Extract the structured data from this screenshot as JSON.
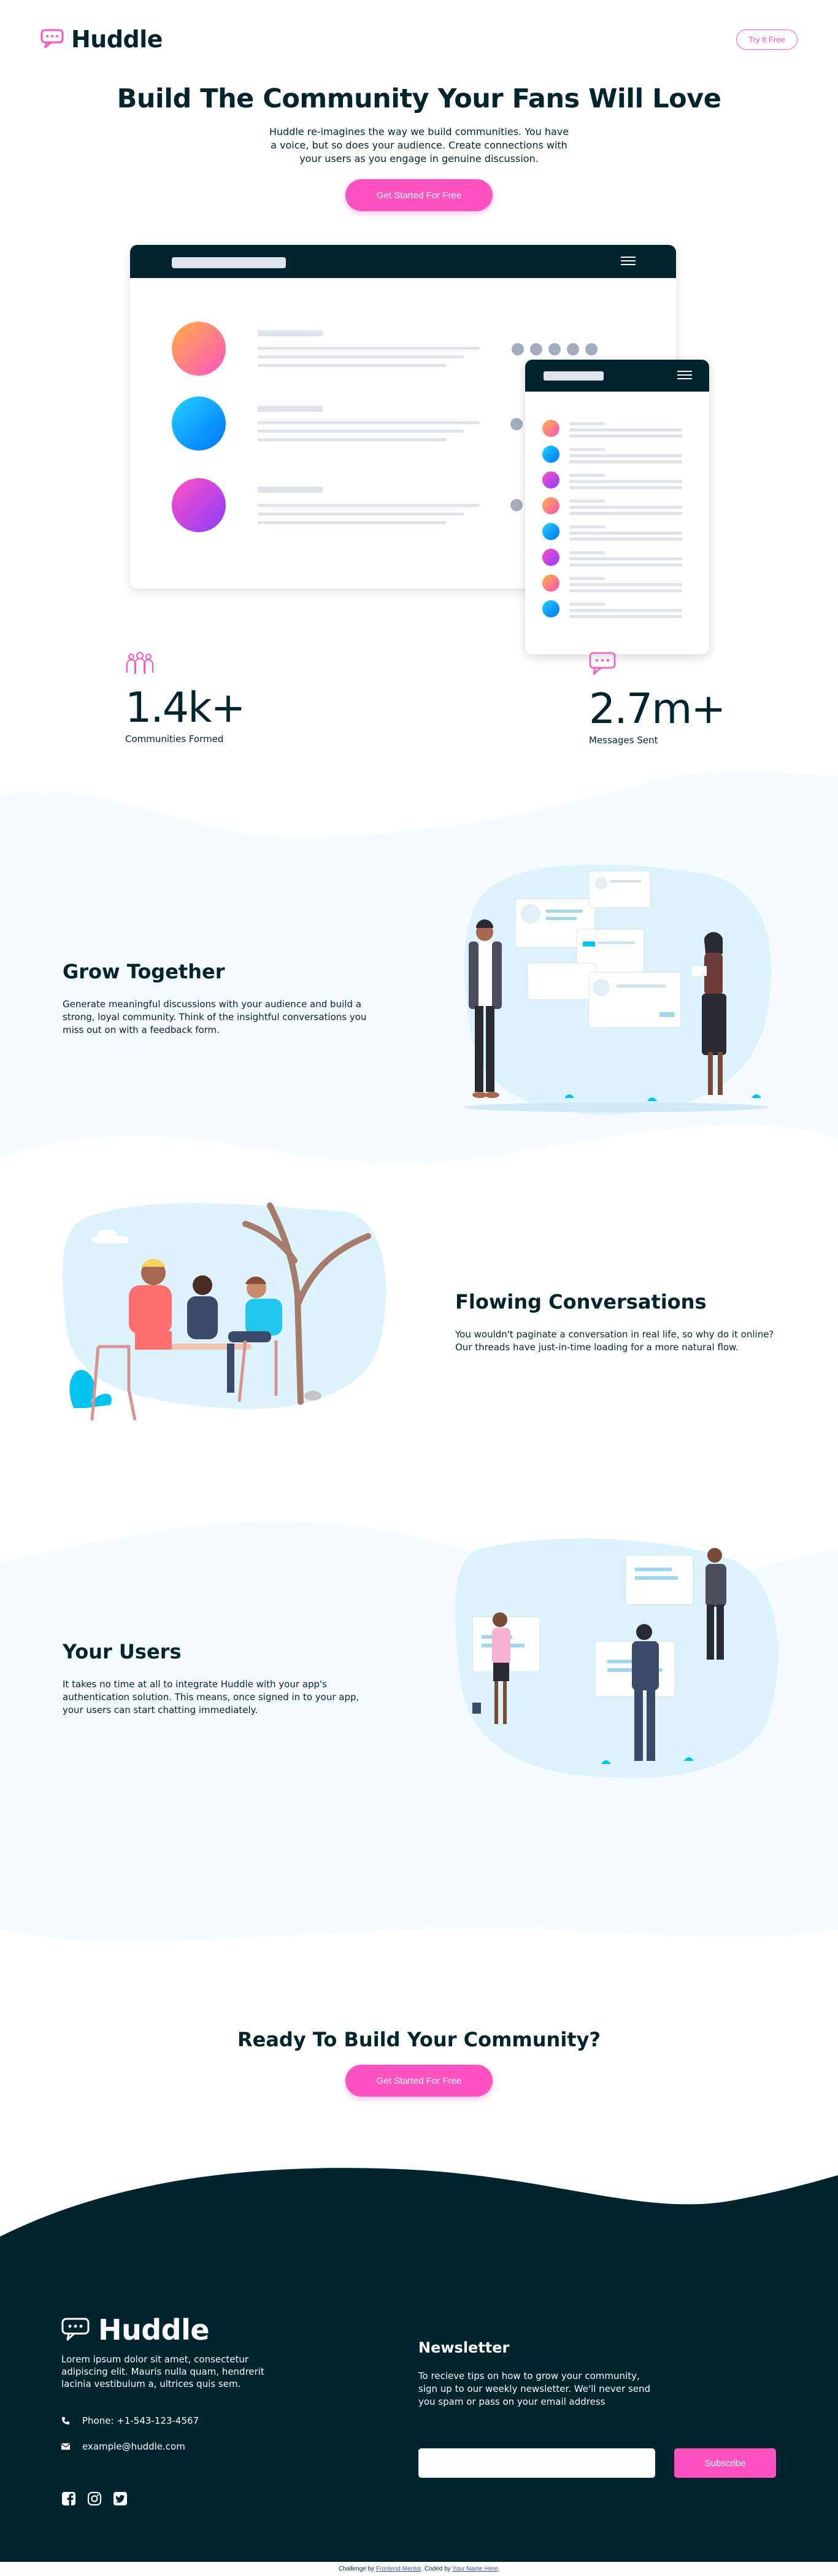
{
  "header": {
    "brand": "Huddle",
    "try_label": "Try It Free"
  },
  "hero": {
    "title": "Build The Community Your Fans Will Love",
    "description": "Huddle re-imagines the way we build communities. You have a voice, but so does your audience. Create connections with your users as you engage in genuine discussion.",
    "cta_label": "Get Started For Free"
  },
  "stats": [
    {
      "value": "1.4k+",
      "label": "Communities Formed",
      "icon": "communities-icon"
    },
    {
      "value": "2.7m+",
      "label": "Messages Sent",
      "icon": "messages-icon"
    }
  ],
  "features": [
    {
      "title": "Grow Together",
      "text": "Generate meaningful discussions with your audience and build a strong, loyal community. Think of the insightful conversations you miss out on with a feedback form."
    },
    {
      "title": "Flowing Conversations",
      "text": "You wouldn't paginate a conversation in real life, so why do it online? Our threads have just-in-time loading for a more natural flow."
    },
    {
      "title": "Your Users",
      "text": "It takes no time at all to integrate Huddle with your app's authentication solution. This means, once signed in to your app, your users can start chatting immediately."
    }
  ],
  "ready": {
    "title": "Ready To Build Your Community?",
    "cta_label": "Get Started For Free"
  },
  "footer": {
    "brand": "Huddle",
    "description": "Lorem ipsum dolor sit amet, consectetur adipiscing elit. Mauris nulla quam, hendrerit lacinia vestibulum a, ultrices quis sem.",
    "phone": "Phone: +1-543-123-4567",
    "email": "example@huddle.com",
    "social": [
      "facebook-icon",
      "instagram-icon",
      "twitter-icon"
    ],
    "newsletter": {
      "title": "Newsletter",
      "text": "To recieve tips on how to grow your community, sign up to our weekly newsletter. We'll never send you spam or pass on your email address",
      "input_value": "",
      "subscribe_label": "Subscribe"
    }
  },
  "attribution": {
    "prefix": "Challenge by",
    "fm": "Frontend Mentor",
    "middle": ". Coded by",
    "author": "Your Name Here",
    "suffix": "."
  },
  "colors": {
    "dark": "#00252e",
    "pink": "#ff52c1",
    "light_bg": "#f5fbff",
    "gray": "#dfe3ea"
  }
}
